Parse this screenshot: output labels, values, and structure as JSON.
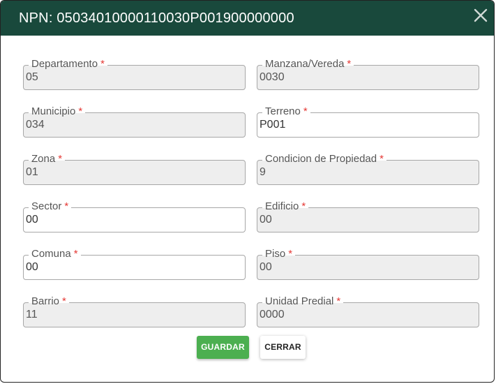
{
  "dialog": {
    "title": "NPN: 05034010000110030P001900000000",
    "close_icon": "close-icon"
  },
  "fields": {
    "departamento": {
      "label": "Departamento",
      "required": "*",
      "value": "05"
    },
    "municipio": {
      "label": "Municipio",
      "required": "*",
      "value": "034"
    },
    "zona": {
      "label": "Zona",
      "required": "*",
      "value": "01"
    },
    "sector": {
      "label": "Sector",
      "required": "*",
      "value": "00"
    },
    "comuna": {
      "label": "Comuna",
      "required": "*",
      "value": "00"
    },
    "barrio": {
      "label": "Barrio",
      "required": "*",
      "value": "11"
    },
    "manzana": {
      "label": "Manzana/Vereda",
      "required": "*",
      "value": "0030"
    },
    "terreno": {
      "label": "Terreno",
      "required": "*",
      "value": "P001"
    },
    "condicion": {
      "label": "Condicion de Propiedad",
      "required": "*",
      "value": "9"
    },
    "edificio": {
      "label": "Edificio",
      "required": "*",
      "value": "00"
    },
    "piso": {
      "label": "Piso",
      "required": "*",
      "value": "00"
    },
    "unidad": {
      "label": "Unidad Predial",
      "required": "*",
      "value": "0000"
    }
  },
  "buttons": {
    "save_label": "GUARDAR",
    "close_label": "CERRAR"
  },
  "colors": {
    "header_bg": "#19493c",
    "save_bg": "#4caf50",
    "required": "#e53935",
    "disabled_field_bg": "#eeeeee"
  }
}
